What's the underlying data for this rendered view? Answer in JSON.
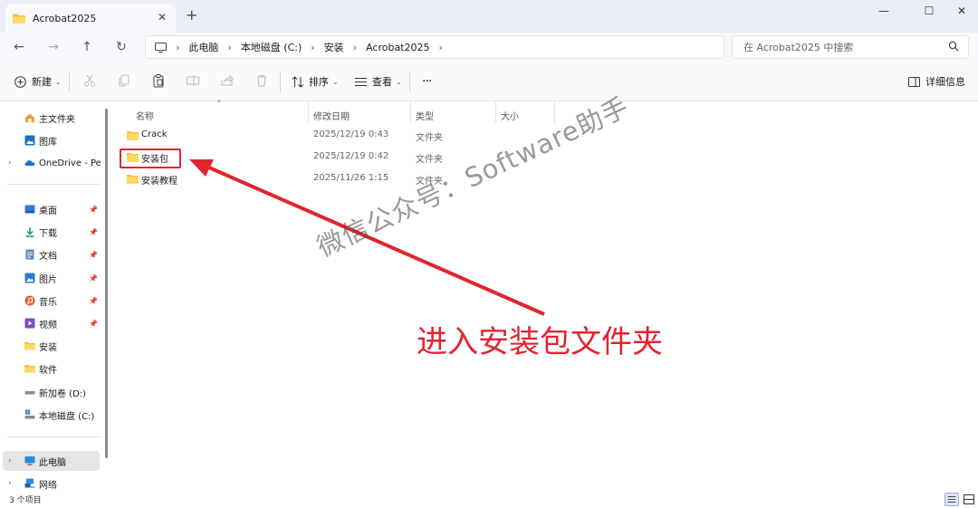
{
  "window": {
    "tab_title": "Acrobat2025",
    "tab_close": "✕",
    "new_tab": "+",
    "minimize": "—",
    "maximize": "☐",
    "close": "✕"
  },
  "nav": {
    "back": "←",
    "forward": "→",
    "up": "↑",
    "refresh": "↻",
    "breadcrumb": [
      "此电脑",
      "本地磁盘 (C:)",
      "安装",
      "Acrobat2025"
    ],
    "search_placeholder": "在 Acrobat2025 中搜索"
  },
  "toolbar": {
    "new_label": "新建",
    "sort_label": "排序",
    "view_label": "查看",
    "more": "···",
    "details_label": "详细信息"
  },
  "sidebar": {
    "items": [
      {
        "label": "主文件夹",
        "icon": "home-icon"
      },
      {
        "label": "图库",
        "icon": "gallery-icon"
      },
      {
        "label": "OneDrive - Per",
        "icon": "onedrive-icon"
      },
      {
        "label": "桌面",
        "icon": "desktop-icon"
      },
      {
        "label": "下载",
        "icon": "download-icon"
      },
      {
        "label": "文档",
        "icon": "document-icon"
      },
      {
        "label": "图片",
        "icon": "picture-icon"
      },
      {
        "label": "音乐",
        "icon": "music-icon"
      },
      {
        "label": "视频",
        "icon": "video-icon"
      },
      {
        "label": "安装",
        "icon": "folder-icon"
      },
      {
        "label": "软件",
        "icon": "folder-icon"
      },
      {
        "label": "新加卷 (D:)",
        "icon": "drive-icon"
      },
      {
        "label": "本地磁盘 (C:)",
        "icon": "system-drive-icon"
      },
      {
        "label": "此电脑",
        "icon": "computer-icon"
      },
      {
        "label": "网络",
        "icon": "network-icon"
      }
    ]
  },
  "columns": {
    "name": "名称",
    "modified": "修改日期",
    "type": "类型",
    "size": "大小"
  },
  "files": [
    {
      "name": "Crack",
      "modified": "2025/12/19 0:43",
      "type": "文件夹"
    },
    {
      "name": "安装包",
      "modified": "2025/12/19 0:42",
      "type": "文件夹"
    },
    {
      "name": "安装教程",
      "modified": "2025/11/26 1:15",
      "type": "文件夹"
    }
  ],
  "status": {
    "item_count": "3 个项目"
  },
  "annotation": {
    "watermark": "微信公众号：Software助手",
    "callout": "进入安装包文件夹",
    "color": "#e0252f"
  }
}
